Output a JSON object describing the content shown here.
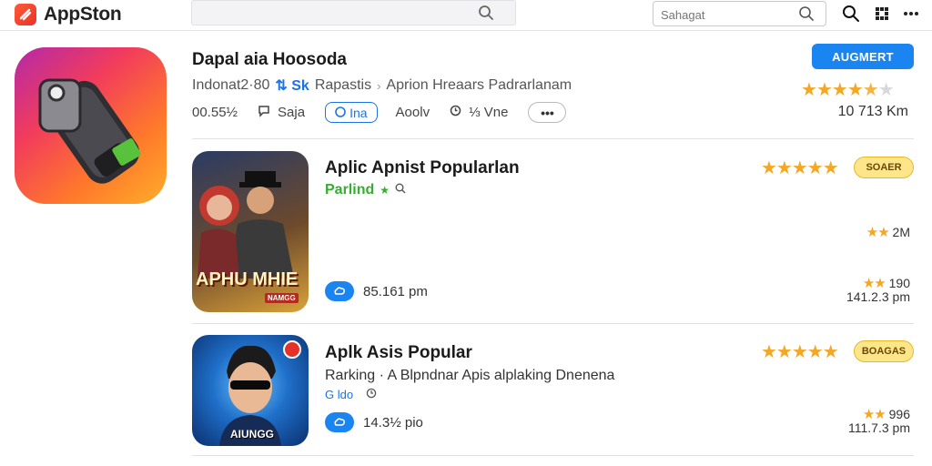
{
  "topbar": {
    "brand_name": "AppSton",
    "search_placeholder": "Sahagat"
  },
  "hero": {
    "title": "Dapal aia Hoosoda",
    "meta_left": "Indonat2·80",
    "meta_badge": "⇅ Sk",
    "meta_mid": "Rapastis",
    "meta_right": "Aprion Hreaars  Padrarlanam",
    "stat1": "00.55½",
    "stat2": "Saja",
    "pill_label": "Ina",
    "stat3": "Aoolv",
    "stat4": "⅓ Vne",
    "install_label": "AUGMERT",
    "rating_stars": 4.5,
    "size": "10 713 Km"
  },
  "apps": [
    {
      "title": "Aplic Apnist Popularlan",
      "sub": "Parlind",
      "sub_color": "#3aaa35",
      "badge": "SOAER",
      "rating_stars": 5,
      "side_rating": "2M",
      "pill_text": "85.161 pm",
      "right1_stars": "★★",
      "right1": "190",
      "right2": "141.2.3 pm",
      "thumb_caption": "APHU MHIE",
      "thumb_sub": "NAMGG"
    },
    {
      "title": "Aplk Asis Popular",
      "sub": "Rarking · A Blpndnar Apis alplaking Dnenena",
      "sub2": "G ldo",
      "sub_color": "#333333",
      "badge": "BOAGAS",
      "rating_stars": 5,
      "pill_text": "14.3½ pio",
      "right1_stars": "★★",
      "right1": "996",
      "right2": "111.7.3 pm",
      "thumb_caption": "AIUNGG"
    }
  ]
}
